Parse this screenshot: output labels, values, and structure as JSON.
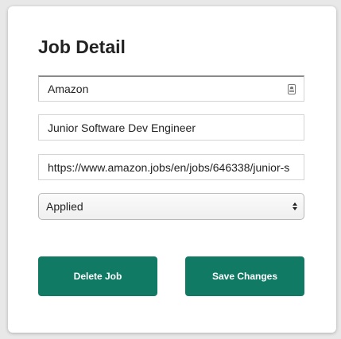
{
  "card": {
    "title": "Job Detail"
  },
  "form": {
    "company": {
      "value": "Amazon",
      "icon": "contact-card-icon"
    },
    "position": {
      "value": "Junior Software Dev Engineer"
    },
    "url": {
      "value": "https://www.amazon.jobs/en/jobs/646338/junior-s"
    },
    "status": {
      "selected": "Applied"
    }
  },
  "actions": {
    "delete_label": "Delete Job",
    "save_label": "Save Changes"
  },
  "colors": {
    "primary_button": "#117a65",
    "background": "#e8e8e8",
    "card": "#ffffff"
  }
}
